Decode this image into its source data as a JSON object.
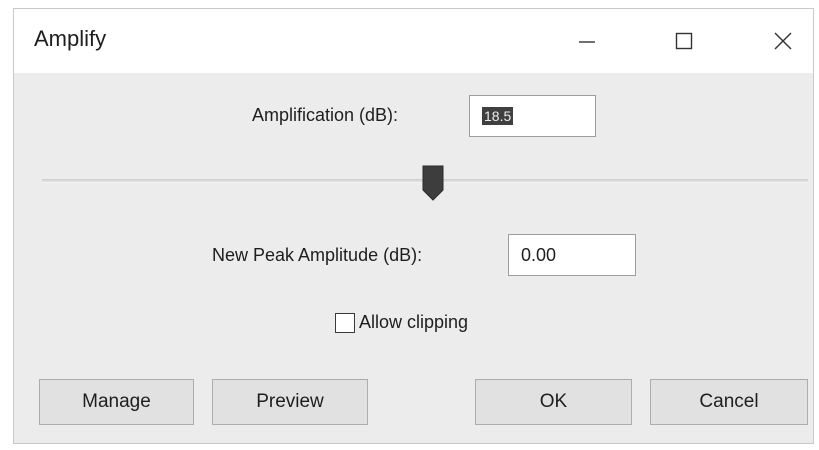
{
  "window": {
    "title": "Amplify",
    "controls": {
      "minimize": "minimize-icon",
      "maximize": "maximize-icon",
      "close": "close-icon"
    }
  },
  "amplification": {
    "label": "Amplification (dB):",
    "value": "18.5"
  },
  "slider": {
    "position": 0.51
  },
  "peak": {
    "label": "New Peak Amplitude (dB):",
    "value": "0.00"
  },
  "clipping": {
    "label": "Allow clipping",
    "checked": false
  },
  "buttons": {
    "manage": "Manage",
    "preview": "Preview",
    "ok": "OK",
    "cancel": "Cancel"
  }
}
